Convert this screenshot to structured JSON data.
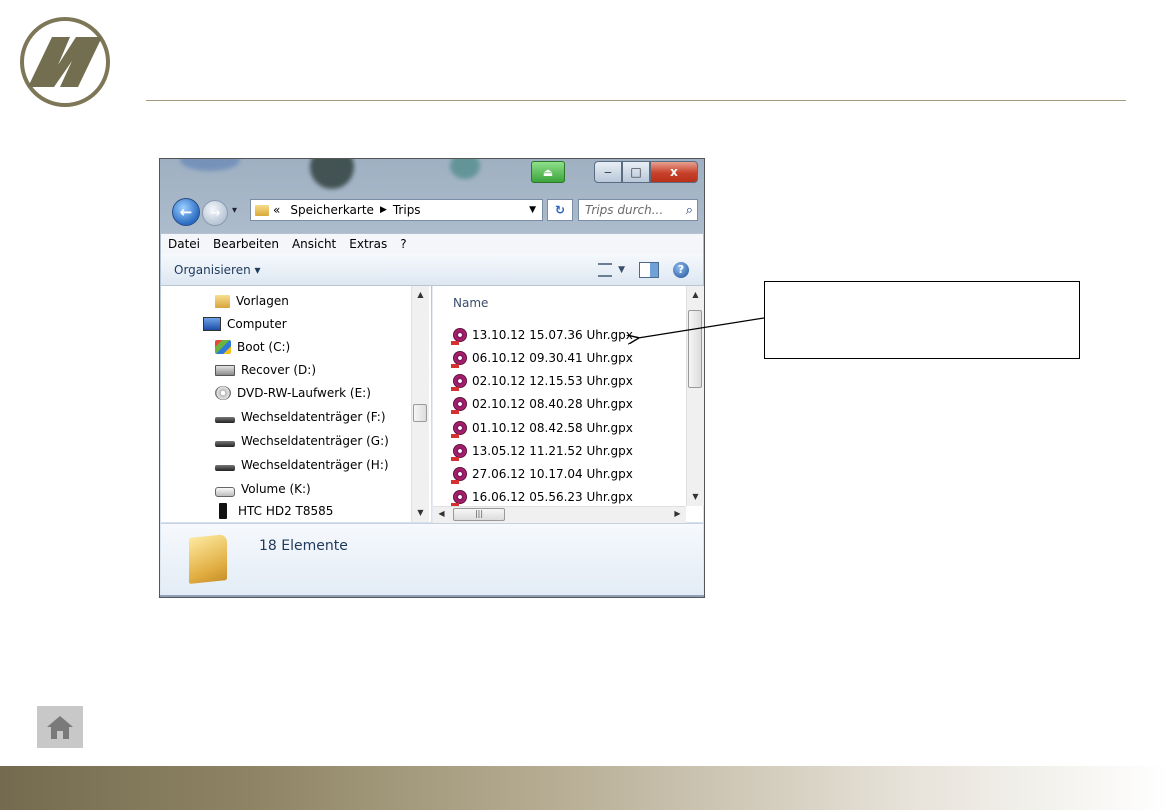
{
  "explorer": {
    "breadcrumb": {
      "prefix": "«",
      "parent": "Speicherkarte",
      "current": "Trips"
    },
    "search_placeholder": "Trips durch...",
    "menu": [
      "Datei",
      "Bearbeiten",
      "Ansicht",
      "Extras",
      "?"
    ],
    "organize_label": "Organisieren ▾",
    "nav_items": [
      {
        "label": "Vorlagen",
        "icon": "folder-icon"
      },
      {
        "label": "Computer",
        "icon": "computer-icon"
      },
      {
        "label": "Boot (C:)",
        "icon": "windows-drive-icon"
      },
      {
        "label": "Recover (D:)",
        "icon": "drive-icon"
      },
      {
        "label": "DVD-RW-Laufwerk (E:)",
        "icon": "dvd-drive-icon"
      },
      {
        "label": "Wechseldatenträger (F:)",
        "icon": "removable-drive-icon"
      },
      {
        "label": "Wechseldatenträger (G:)",
        "icon": "removable-drive-icon"
      },
      {
        "label": "Wechseldatenträger (H:)",
        "icon": "removable-drive-icon"
      },
      {
        "label": "Volume (K:)",
        "icon": "volume-drive-icon"
      },
      {
        "label": "HTC HD2 T8585",
        "icon": "phone-icon"
      }
    ],
    "column_name": "Name",
    "files": [
      "13.10.12 15.07.36 Uhr.gpx",
      "06.10.12 09.30.41 Uhr.gpx",
      "02.10.12 12.15.53 Uhr.gpx",
      "02.10.12 08.40.28 Uhr.gpx",
      "01.10.12 08.42.58 Uhr.gpx",
      "13.05.12 11.21.52 Uhr.gpx",
      "27.06.12 10.17.04 Uhr.gpx",
      "16.06.12 05.56.23 Uhr.gpx"
    ],
    "status_count": "18 Elemente",
    "window_buttons": {
      "minimize": "‒",
      "maximize": "□",
      "close": "x"
    }
  },
  "colors": {
    "rule": "#a59a80",
    "footer_start": "#746a4f",
    "logo_olive": "#6f6a4a"
  }
}
